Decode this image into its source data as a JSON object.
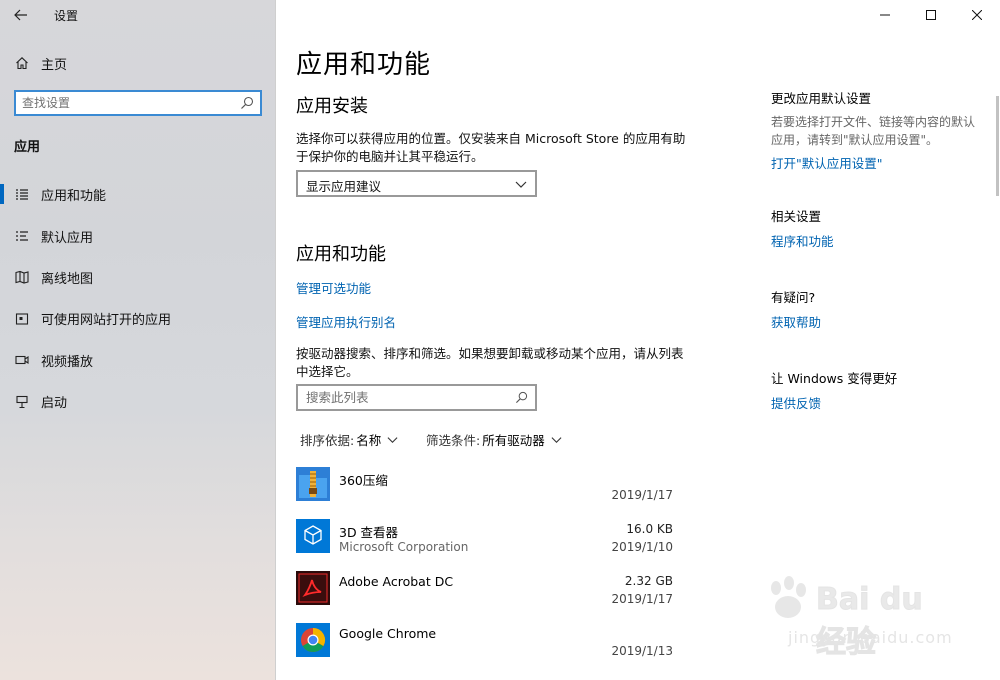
{
  "window": {
    "title": "设置",
    "controls": {
      "minimize": "—",
      "maximize": "☐",
      "close": "✕"
    }
  },
  "sidebar": {
    "home_label": "主页",
    "search_placeholder": "查找设置",
    "section_label": "应用",
    "items": [
      {
        "label": "应用和功能",
        "icon": "apps-features-icon",
        "selected": true
      },
      {
        "label": "默认应用",
        "icon": "default-apps-icon",
        "selected": false
      },
      {
        "label": "离线地图",
        "icon": "offline-maps-icon",
        "selected": false
      },
      {
        "label": "可使用网站打开的应用",
        "icon": "apps-for-websites-icon",
        "selected": false
      },
      {
        "label": "视频播放",
        "icon": "video-playback-icon",
        "selected": false
      },
      {
        "label": "启动",
        "icon": "startup-icon",
        "selected": false
      }
    ]
  },
  "main": {
    "page_title": "应用和功能",
    "install": {
      "heading": "应用安装",
      "description": "选择你可以获得应用的位置。仅安装来自 Microsoft Store 的应用有助于保护你的电脑并让其平稳运行。",
      "dropdown_value": "显示应用建议"
    },
    "features": {
      "heading": "应用和功能",
      "link_optional": "管理可选功能",
      "link_alias": "管理应用执行别名",
      "description": "按驱动器搜索、排序和筛选。如果想要卸载或移动某个应用，请从列表中选择它。",
      "search_placeholder": "搜索此列表",
      "sort_label": "排序依据:",
      "sort_value": "名称",
      "filter_label": "筛选条件:",
      "filter_value": "所有驱动器"
    },
    "apps": [
      {
        "name": "360压缩",
        "publisher": "",
        "size": "",
        "date": "2019/1/17",
        "icon": "360zip-icon"
      },
      {
        "name": "3D 查看器",
        "publisher": "Microsoft Corporation",
        "size": "16.0 KB",
        "date": "2019/1/10",
        "icon": "3d-viewer-icon"
      },
      {
        "name": "Adobe Acrobat DC",
        "publisher": "",
        "size": "2.32 GB",
        "date": "2019/1/17",
        "icon": "acrobat-icon"
      },
      {
        "name": "Google Chrome",
        "publisher": "",
        "size": "",
        "date": "2019/1/13",
        "icon": "chrome-icon"
      }
    ]
  },
  "right": {
    "defaults_title": "更改应用默认设置",
    "defaults_text": "若要选择打开文件、链接等内容的默认应用，请转到\"默认应用设置\"。",
    "defaults_link": "打开\"默认应用设置\"",
    "related_title": "相关设置",
    "related_link": "程序和功能",
    "help_title": "有疑问?",
    "help_link": "获取帮助",
    "feedback_title": "让 Windows 变得更好",
    "feedback_link": "提供反馈"
  },
  "watermark": {
    "text": "Bai du 经验",
    "sub": "jingyan.baidu.com"
  },
  "colors": {
    "accent": "#0067c0",
    "link": "#0063b1",
    "search_border": "#3a8ad3"
  }
}
